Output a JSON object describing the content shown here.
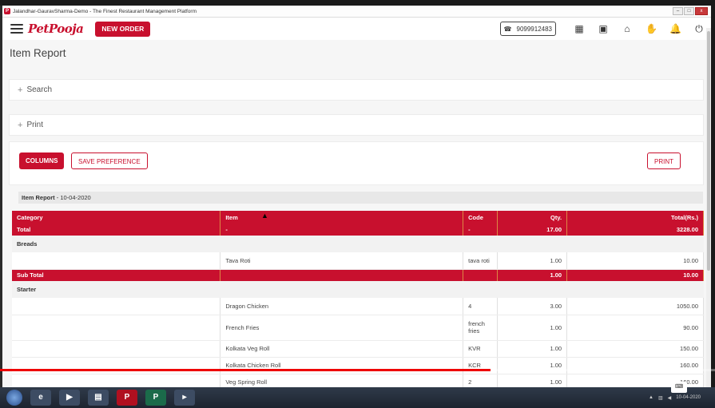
{
  "window": {
    "title": "Jalandhar-GauravSharma-Demo - The Finest Restaurant Management Platform",
    "controls": [
      "–",
      "□",
      "x"
    ]
  },
  "header": {
    "logo": "PetPooja",
    "new_order": "NEW ORDER",
    "phone": "9099912483",
    "icons": [
      "dashboard-icon",
      "pos-icon",
      "dine-in-icon",
      "hand-icon",
      "bell-icon",
      "power-icon"
    ]
  },
  "page": {
    "title": "Item Report",
    "panels": [
      {
        "label": "Search"
      },
      {
        "label": "Print"
      }
    ],
    "buttons": {
      "columns": "COLUMNS",
      "save_pref": "SAVE PREFERENCE",
      "print": "PRINT"
    },
    "report_label": "Item Report",
    "report_date": " - 10-04-2020"
  },
  "table": {
    "headers": [
      "Category",
      "Item",
      "Code",
      "Qty.",
      "Total(Rs.)"
    ],
    "total": {
      "label": "Total",
      "item": "-",
      "code": "-",
      "qty": "17.00",
      "amount": "3228.00"
    },
    "groups": [
      {
        "category": "Breads",
        "rows": [
          {
            "item": "Tava Roti",
            "code": "tava roti",
            "qty": "1.00",
            "total": "10.00"
          }
        ],
        "subtotal": {
          "label": "Sub Total",
          "qty": "1.00",
          "total": "10.00"
        }
      },
      {
        "category": "Starter",
        "rows": [
          {
            "item": "Dragon Chicken",
            "code": "4",
            "qty": "3.00",
            "total": "1050.00"
          },
          {
            "item": "French Fries",
            "code": "french fries",
            "qty": "1.00",
            "total": "90.00"
          },
          {
            "item": "Kolkata Veg Roll",
            "code": "KVR",
            "qty": "1.00",
            "total": "150.00"
          },
          {
            "item": "Kolkata Chicken Roll",
            "code": "KCR",
            "qty": "1.00",
            "total": "160.00"
          },
          {
            "item": "Veg Spring Roll",
            "code": "2",
            "qty": "1.00",
            "total": "160.00"
          }
        ]
      }
    ]
  },
  "video": {
    "progress": 0.686
  },
  "taskbar": {
    "date": "10-04-2020"
  },
  "colors": {
    "brand": "#c8102e"
  }
}
